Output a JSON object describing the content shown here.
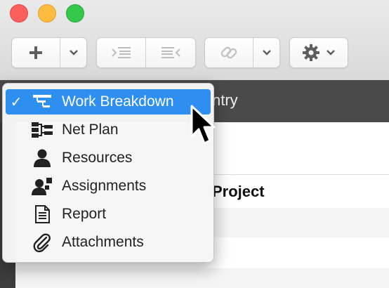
{
  "window": {
    "buttons": [
      "close",
      "minimize",
      "zoom"
    ]
  },
  "toolbar": {
    "add_icon": "plus-icon",
    "add_menu_icon": "chevron-down-icon",
    "indent_icon": "indent-icon",
    "outdent_icon": "outdent-icon",
    "link_icon": "link-icon",
    "link_menu_icon": "chevron-down-icon",
    "settings_icon": "gear-icon",
    "settings_menu_icon": "chevron-down-icon"
  },
  "header": {
    "partial_label": "ntry"
  },
  "table": {
    "partial_header": "Project"
  },
  "view_menu": {
    "selected_check": "✓",
    "items": [
      {
        "label": "Work Breakdown",
        "icon": "work-breakdown-icon",
        "selected": true
      },
      {
        "label": "Net Plan",
        "icon": "net-plan-icon",
        "selected": false
      },
      {
        "label": "Resources",
        "icon": "person-icon",
        "selected": false
      },
      {
        "label": "Assignments",
        "icon": "assignments-icon",
        "selected": false
      },
      {
        "label": "Report",
        "icon": "report-icon",
        "selected": false
      },
      {
        "label": "Attachments",
        "icon": "paperclip-icon",
        "selected": false
      }
    ]
  },
  "colors": {
    "selection": "#2f8ff0",
    "dark_header": "#4a4a4a"
  }
}
